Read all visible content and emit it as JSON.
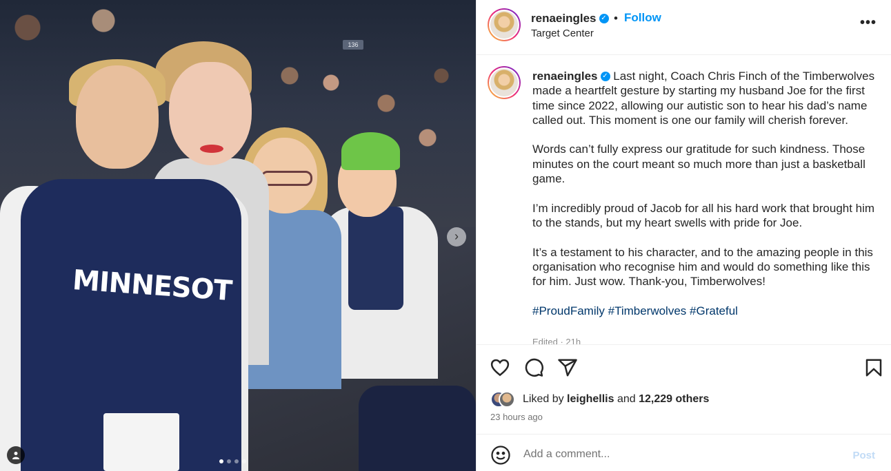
{
  "post": {
    "username": "renaeingles",
    "follow_label": "Follow",
    "separator": "•",
    "location": "Target Center",
    "more_label": "•••"
  },
  "media": {
    "stand_section": "136",
    "jersey_text": "MINNESOT",
    "carousel_count": 4,
    "carousel_active": 0
  },
  "caption": {
    "username": "renaeingles",
    "paragraphs": [
      "Last night, Coach Chris Finch of the Timberwolves made a heartfelt gesture by starting my husband Joe for the first time since 2022, allowing our autistic son to hear his dad’s name called out. This moment is one our family will cherish forever.",
      "Words can’t fully express our gratitude for such kindness. Those minutes on the court meant so much more than just a basketball game.",
      "I’m incredibly proud of Jacob for all his hard work that brought him to the stands, but my heart swells with pride for Joe.",
      "It’s a testament to his character, and to the amazing people in this organisation who recognise him and would do something like this for him. Just wow. Thank-you, Timberwolves!"
    ],
    "hashtags": [
      "#ProudFamily",
      "#Timberwolves",
      "#Grateful"
    ],
    "edited": "Edited · 21h"
  },
  "actions": {
    "liked_by_prefix": "Liked by",
    "liked_by_user": "leighellis",
    "liked_by_and": "and",
    "liked_by_others": "12,229 others",
    "time_ago": "23 hours ago"
  },
  "comment": {
    "placeholder": "Add a comment...",
    "post_label": "Post"
  },
  "colors": {
    "link_blue": "#0095f6",
    "hashtag": "#00376b",
    "post_disabled": "#c1dbf6"
  },
  "icons": [
    "heart-icon",
    "comment-icon",
    "share-icon",
    "bookmark-icon",
    "emoji-icon",
    "verified-badge-icon",
    "chevron-right-icon",
    "user-tag-icon",
    "more-options-icon"
  ]
}
